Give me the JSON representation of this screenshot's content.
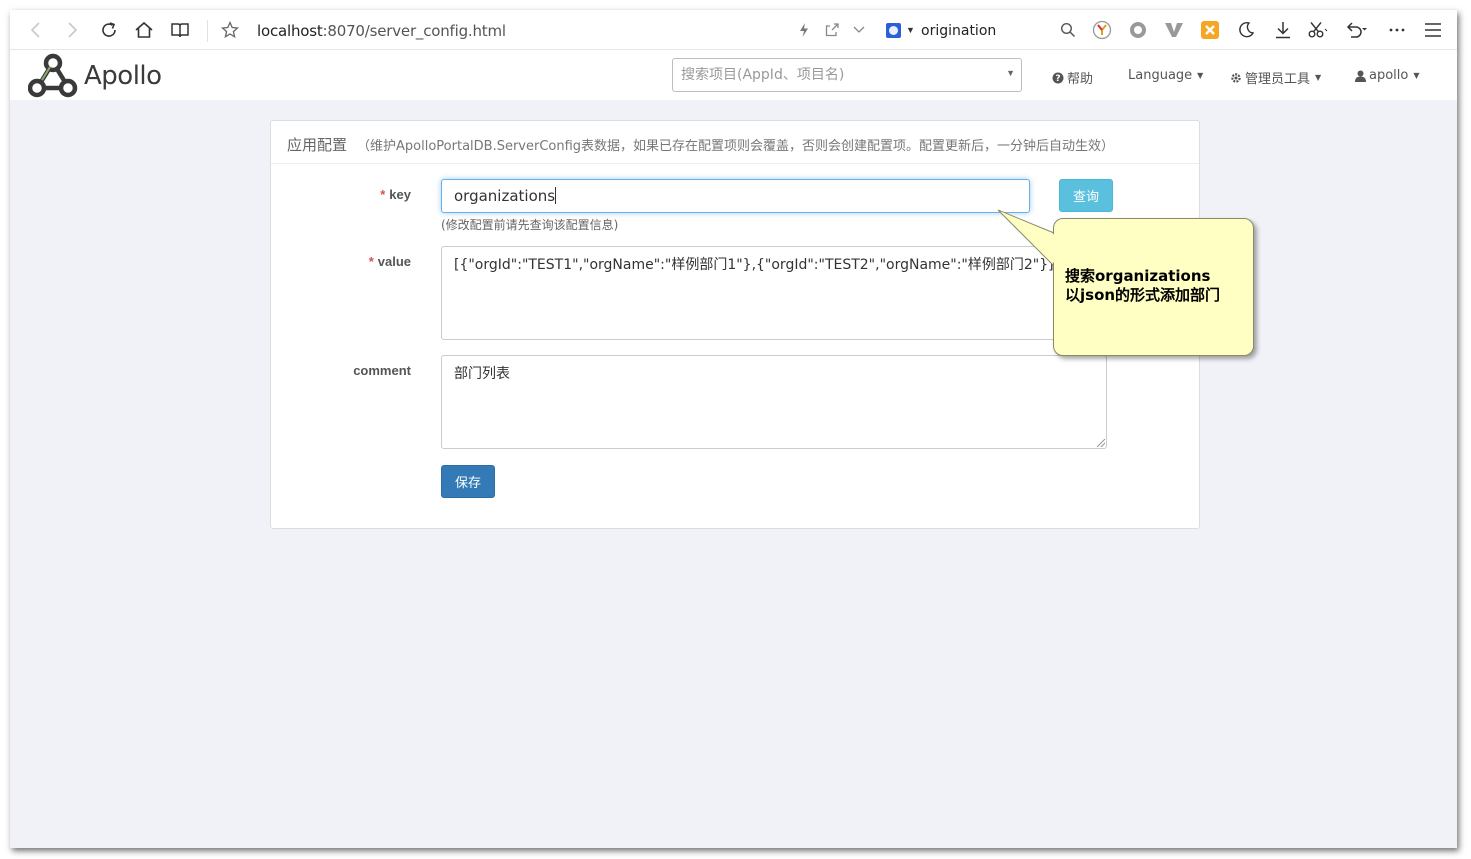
{
  "browser": {
    "url_host": "localhost",
    "url_rest": ":8070/server_config.html",
    "search_text": "origination",
    "icons": [
      "back-icon",
      "forward-icon",
      "reload-icon",
      "home-icon",
      "reader-icon",
      "star-icon",
      "lightning-icon",
      "share-icon",
      "chevron-down-icon",
      "search-engine-icon",
      "search-icon",
      "extension-icon",
      "circle-icon",
      "v-icon",
      "game-icon",
      "moon-icon",
      "download-icon",
      "scissors-icon",
      "undo-icon",
      "more-icon",
      "menu-icon"
    ]
  },
  "navbar": {
    "logo_text": "Apollo",
    "search_placeholder": "搜索项目(AppId、项目名)",
    "help": "帮助",
    "language": "Language",
    "admin_tools": "管理员工具",
    "user": "apollo"
  },
  "panel": {
    "title": "应用配置",
    "subtitle": "（维护ApolloPortalDB.ServerConfig表数据，如果已存在配置项则会覆盖，否则会创建配置项。配置更新后，一分钟后自动生效）",
    "key_label": "key",
    "key_value": "organizations",
    "key_hint": "(修改配置前请先查询该配置信息)",
    "query_button": "查询",
    "value_label": "value",
    "value_text": "[{\"orgId\":\"TEST1\",\"orgName\":\"样例部门1\"},{\"orgId\":\"TEST2\",\"orgName\":\"样例部门2\"}]",
    "comment_label": "comment",
    "comment_text": "部门列表",
    "save_button": "保存",
    "required_mark": "*"
  },
  "callout": {
    "line1": "搜索organizations",
    "line2": "以json的形式添加部门"
  },
  "colors": {
    "query_button": "#5bc0de",
    "save_button": "#337ab7",
    "callout_bg": "#ffffc4",
    "page_bg": "#f1f2f7"
  }
}
